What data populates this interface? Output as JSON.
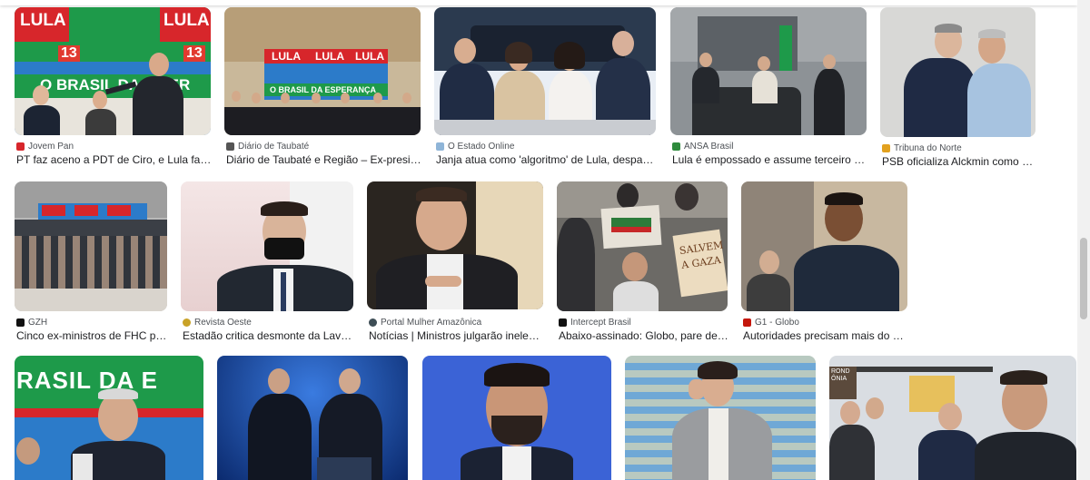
{
  "results": [
    {
      "source": "Jovem Pan",
      "fav_color": "#d7262b",
      "title": "PT faz aceno a PDT de Ciro, e Lula fala e…",
      "banner_text": "LULA",
      "number": "13",
      "slogan": "O BRASIL DA E PER"
    },
    {
      "source": "Diário de Taubaté",
      "fav_color": "#555555",
      "title": "Diário de Taubaté e Região – Ex-preside…",
      "banner_text": "LULA",
      "slogan": "O BRASIL DA ESPERANÇA"
    },
    {
      "source": "O Estado Online",
      "fav_color": "#8fb5d8",
      "title": "Janja atua como 'algoritmo' de Lula, despach…"
    },
    {
      "source": "ANSA Brasil",
      "fav_color": "#2e8b3d",
      "title": "Lula é empossado e assume terceiro m…"
    },
    {
      "source": "Tribuna do Norte",
      "fav_color": "#e2a11f",
      "title": "PSB oficializa Alckmin como vi…"
    },
    {
      "source": "GZH",
      "fav_color": "#111111",
      "title": "Cinco ex-ministros de FHC par…"
    },
    {
      "source": "Revista Oeste",
      "fav_color": "#c9a227",
      "title": "Estadão critica desmonte da Lava …"
    },
    {
      "source": "Portal Mulher Amazônica",
      "fav_color": "#3d4d55",
      "title": "Notícias | Ministros julgarão inelegi…"
    },
    {
      "source": "Intercept Brasil",
      "fav_color": "#111111",
      "title": "Abaixo-assinado: Globo, pare de d…"
    },
    {
      "source": "G1 - Globo",
      "fav_color": "#c4170c",
      "title": "Autoridades precisam mais do qu…"
    },
    {
      "banner_text": "RASIL DA E"
    },
    {},
    {},
    {},
    {
      "sign_text": "RONDÔNIA"
    }
  ],
  "image_texts": {
    "gaza_sign": "SALVEM A GAZA"
  },
  "colors": {
    "link_text": "#202124",
    "source_text": "#4d5156",
    "lula_red": "#d7262b",
    "lula_green": "#1e9a4a"
  }
}
